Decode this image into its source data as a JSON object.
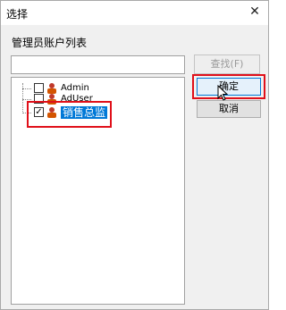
{
  "window": {
    "title": "选择",
    "close_glyph": "✕"
  },
  "list_label": "管理员账户列表",
  "search": {
    "value": "",
    "button": "查找(F)"
  },
  "buttons": {
    "ok": "确定",
    "cancel": "取消"
  },
  "tree": {
    "items": [
      {
        "label": "Admin",
        "checked": false,
        "selected": false,
        "icon": "user-icon"
      },
      {
        "label": "AdUser",
        "checked": false,
        "selected": false,
        "icon": "user-icon"
      },
      {
        "label": "销售总监",
        "checked": true,
        "selected": true,
        "icon": "user-icon"
      }
    ]
  },
  "colors": {
    "highlight": "#e0101a",
    "selection": "#0078d7"
  }
}
